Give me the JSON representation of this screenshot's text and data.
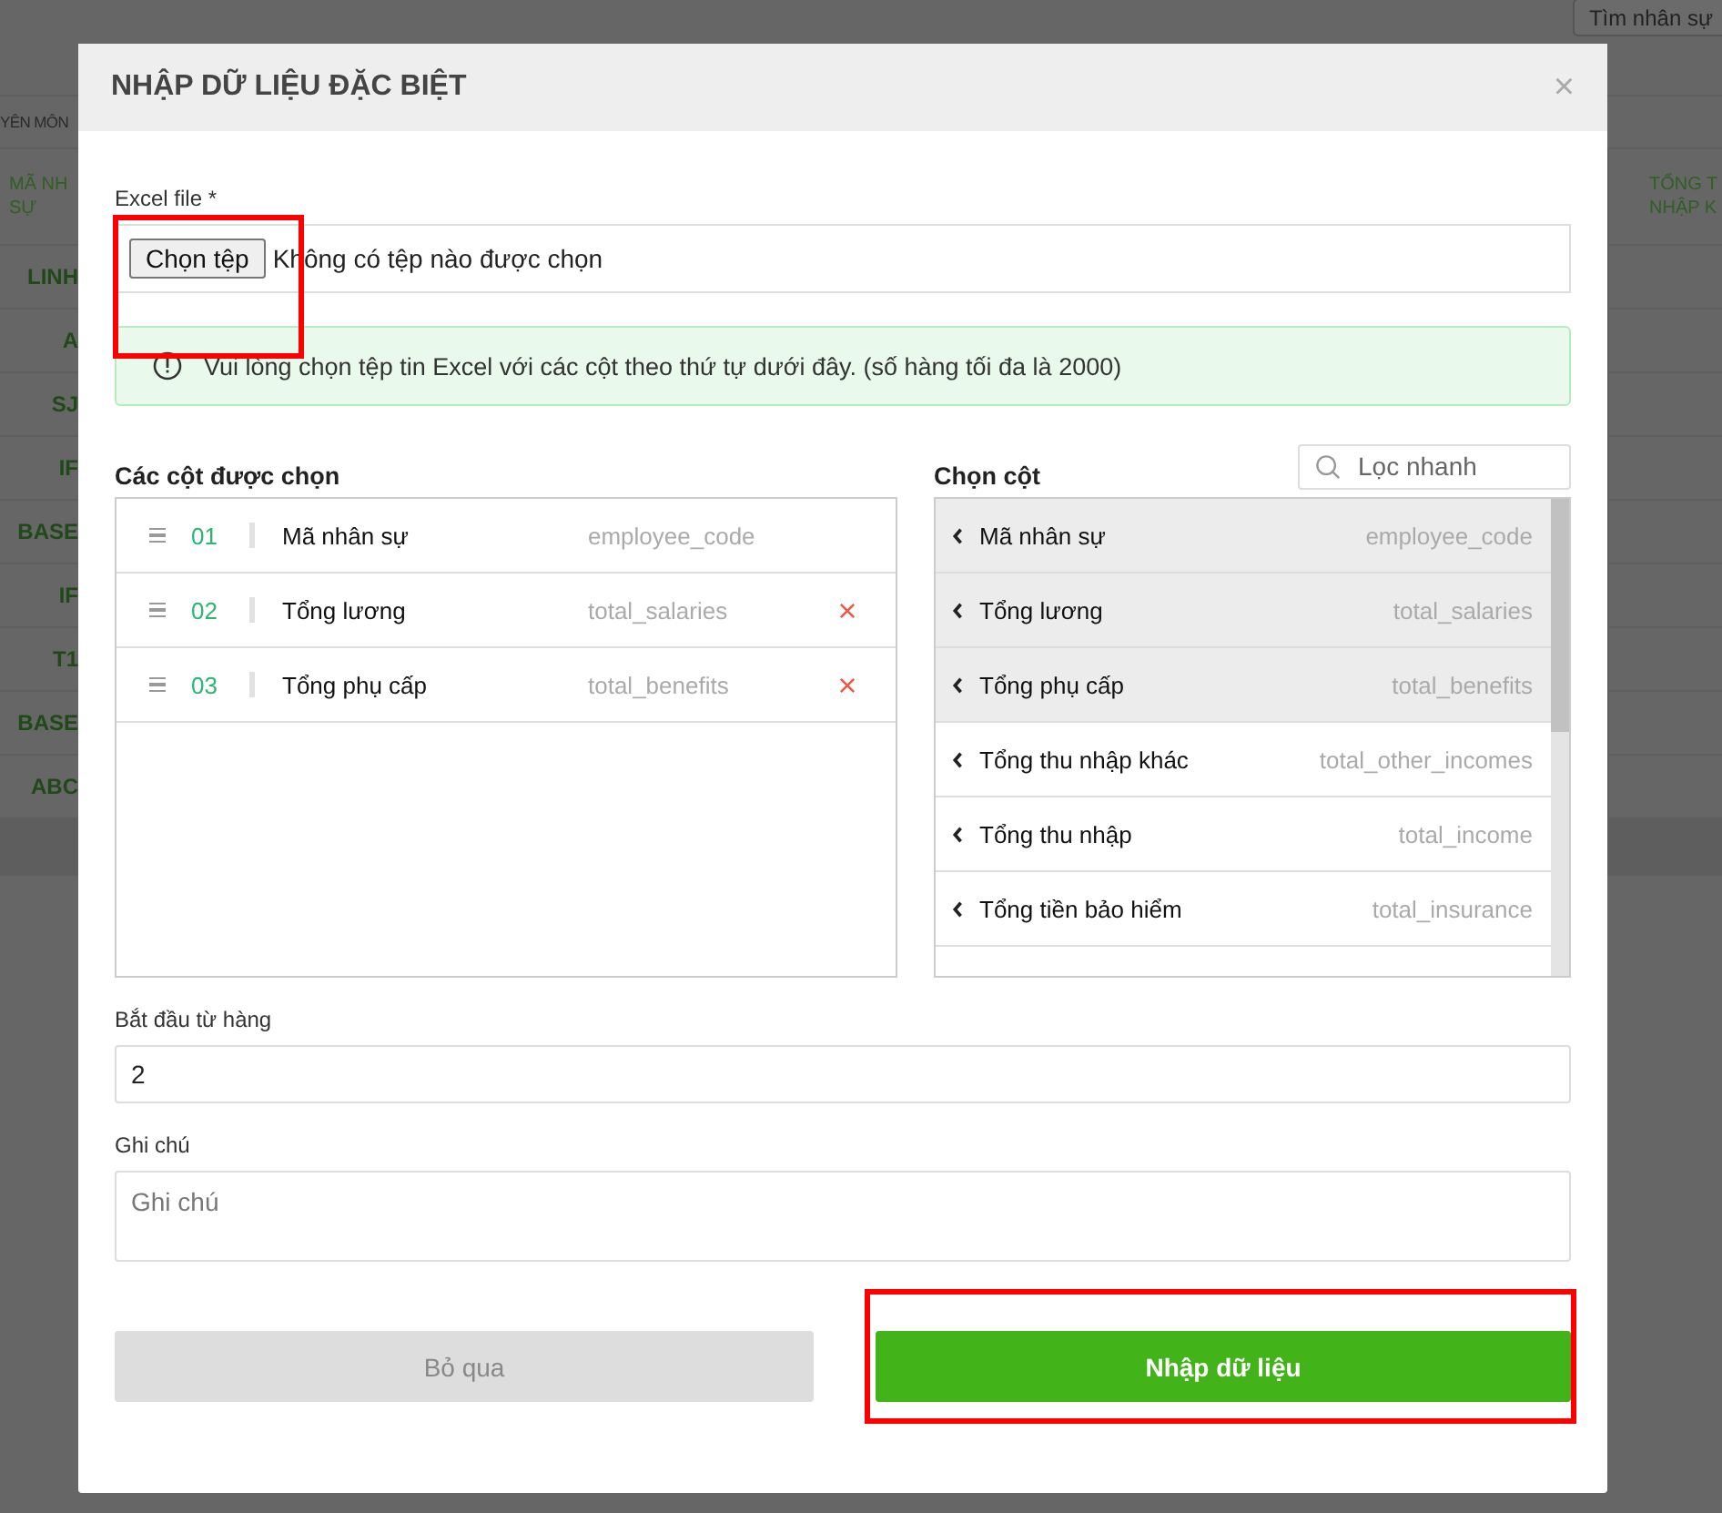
{
  "background_page": {
    "search_button": "Tìm nhân sự",
    "tab_fragment": "YÊN MÔN",
    "left_header": [
      "MÃ NH",
      "SỰ"
    ],
    "left_cells": [
      "LINH",
      "A",
      "SJ",
      "IF",
      "BASE",
      "IF",
      "T1",
      "BASE",
      "ABC"
    ],
    "right_header": [
      "TỔNG T",
      "NHẬP K"
    ]
  },
  "dialog": {
    "title": "NHẬP DỮ LIỆU ĐẶC BIỆT",
    "close": "×",
    "file": {
      "label": "Excel file *",
      "button": "Chọn tệp",
      "status": "Không có tệp nào được chọn"
    },
    "notice": "Vui lòng chọn tệp tin Excel với các cột theo thứ tự dưới đây. (số hàng tối đa là 2000)",
    "selected_columns": {
      "title": "Các cột được chọn",
      "items": [
        {
          "index": "01",
          "name": "Mã nhân sự",
          "key": "employee_code",
          "removable": false
        },
        {
          "index": "02",
          "name": "Tổng lương",
          "key": "total_salaries",
          "removable": true
        },
        {
          "index": "03",
          "name": "Tổng phụ cấp",
          "key": "total_benefits",
          "removable": true
        }
      ]
    },
    "available_columns": {
      "title": "Chọn cột",
      "search": {
        "placeholder": "Lọc nhanh"
      },
      "items": [
        {
          "name": "Mã nhân sự",
          "key": "employee_code",
          "selected": true
        },
        {
          "name": "Tổng lương",
          "key": "total_salaries",
          "selected": true
        },
        {
          "name": "Tổng phụ cấp",
          "key": "total_benefits",
          "selected": true
        },
        {
          "name": "Tổng thu nhập khác",
          "key": "total_other_incomes",
          "selected": false
        },
        {
          "name": "Tổng thu nhập",
          "key": "total_income",
          "selected": false
        },
        {
          "name": "Tổng tiền bảo hiểm",
          "key": "total_insurance",
          "selected": false
        }
      ]
    },
    "start_row": {
      "label": "Bắt đầu từ hàng",
      "value": "2"
    },
    "note": {
      "label": "Ghi chú",
      "placeholder": "Ghi chú"
    },
    "buttons": [
      {
        "label": "Bỏ qua",
        "kind": "cancel",
        "highlighted": false
      },
      {
        "label": "Nhập dữ liệu",
        "kind": "primary",
        "highlighted": true
      }
    ]
  }
}
